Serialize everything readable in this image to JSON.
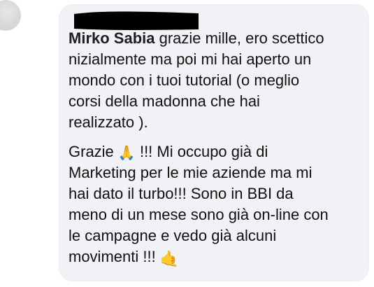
{
  "comment": {
    "author_name": "Mirko Sabia",
    "lines": [
      "grazie mille, ero scettico",
      "nizialmente ma poi mi hai aperto un",
      "mondo con i tuoi tutorial (o meglio",
      "corsi della madonna che hai",
      "realizzato ).",
      "Grazie",
      "!!! Mi occupo già di",
      "Marketing per le  mie aziende ma mi",
      "hai dato il turbo!!!  Sono in BBI da",
      "meno di un mese sono già on-line con",
      "le campagne e vedo già alcuni",
      "movimenti !!!"
    ],
    "emoji": {
      "praying": "🙏",
      "call_me": "🤙"
    }
  },
  "colors": {
    "bubble": "#f0f2f5",
    "text": "#111111",
    "name": "#1c1e21"
  }
}
